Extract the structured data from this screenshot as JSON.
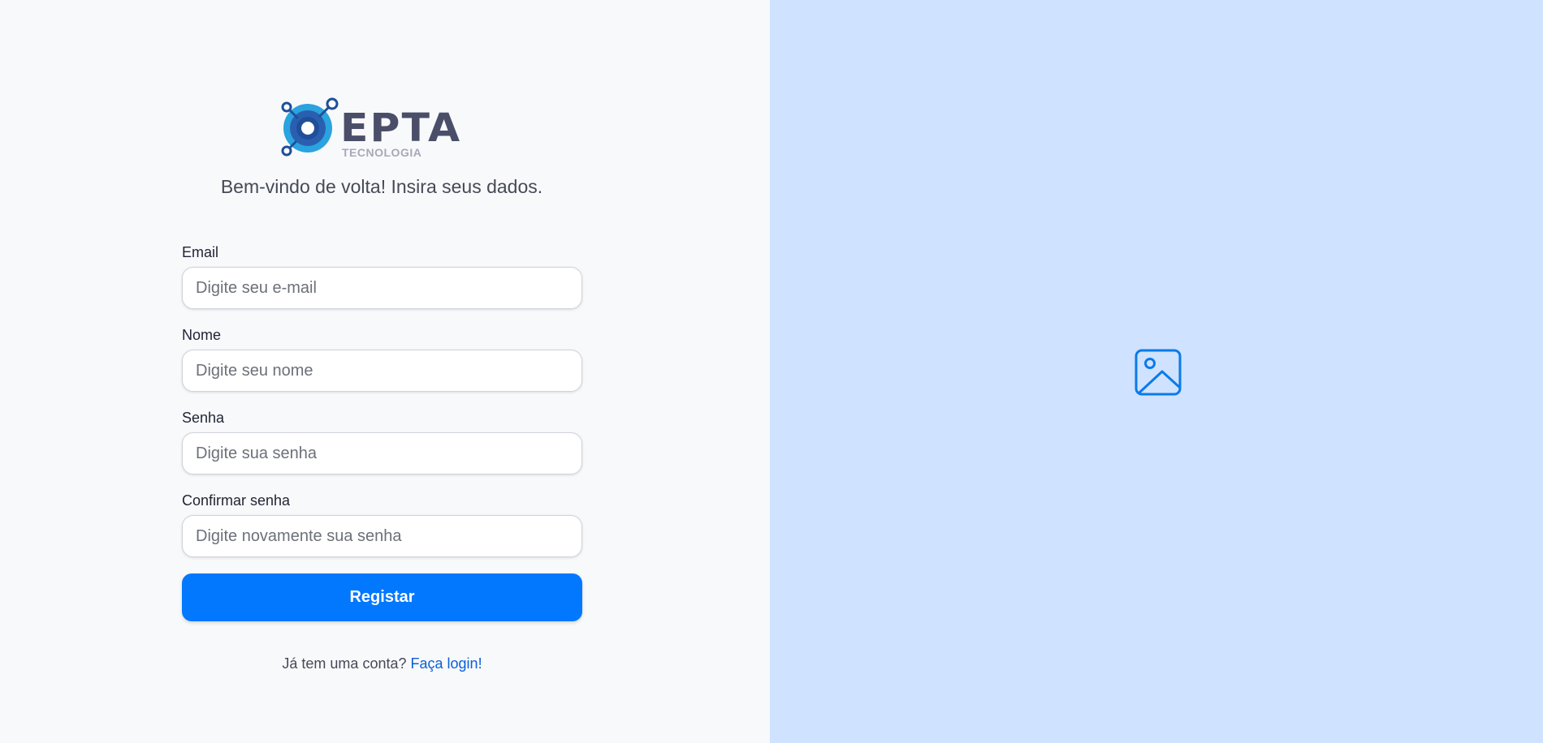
{
  "brand": {
    "name": "EPTA",
    "tagline": "TECNOLOGIA",
    "colors": {
      "primary": "#0278ff",
      "logo_text": "#4a4e69",
      "logo_ring": "#29a8e0"
    }
  },
  "header": {
    "subtitle": "Bem-vindo de volta! Insira seus dados."
  },
  "form": {
    "email": {
      "label": "Email",
      "placeholder": "Digite seu e-mail",
      "value": ""
    },
    "name": {
      "label": "Nome",
      "placeholder": "Digite seu nome",
      "value": ""
    },
    "password": {
      "label": "Senha",
      "placeholder": "Digite sua senha",
      "value": ""
    },
    "confirm_password": {
      "label": "Confirmar senha",
      "placeholder": "Digite novamente sua senha",
      "value": ""
    },
    "submit_label": "Registar"
  },
  "footer": {
    "prompt": "Já tem uma conta?",
    "login_link": "Faça login!"
  },
  "side_panel": {
    "icon": "image-icon",
    "background": "#cfe2ff"
  }
}
